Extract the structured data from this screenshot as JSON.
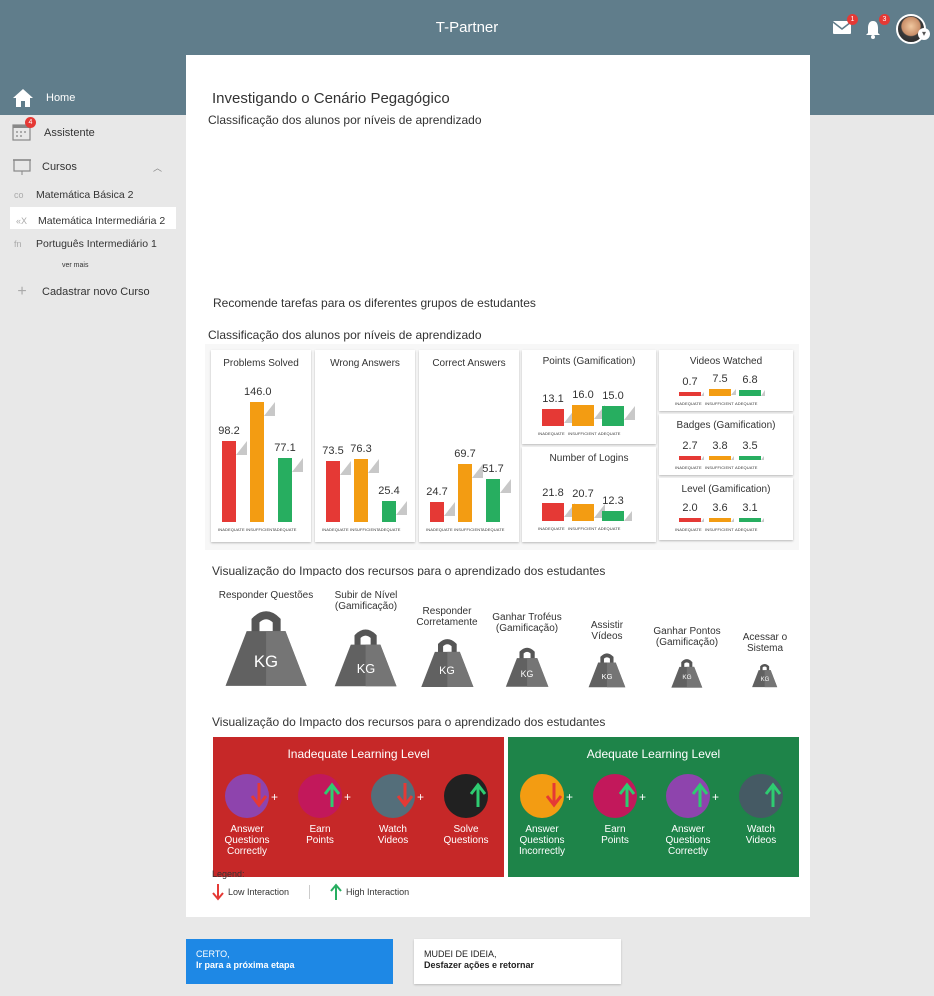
{
  "app": {
    "title": "T-Partner",
    "mail_count": "1",
    "notif_count": "3"
  },
  "sidebar": {
    "home": "Home",
    "assistant": "Assistente",
    "assistant_badge": "4",
    "courses": "Cursos",
    "courses_list": [
      {
        "icon": "co",
        "label": "Matemática Básica 2"
      },
      {
        "icon": "«X",
        "label": "Matemática Intermediária 2"
      },
      {
        "icon": "fn",
        "label": "Português Intermediário 1"
      }
    ],
    "see_more": "ver mais",
    "add_course": "Cadastrar novo Curso"
  },
  "main": {
    "title": "Investigando o Cenário Pegagógico",
    "subtitle1": "Classificação dos alunos por níveis de aprendizado",
    "recommend": "Recomende tarefas para os diferentes grupos de estudantes",
    "subtitle2": "Classificação dos alunos por níveis de aprendizado",
    "viz1": "Visualização do Impacto dos recursos para o aprendizado dos estudantes",
    "viz2": "Visualização do Impacto dos recursos para o aprendizado dos estudantes"
  },
  "chart_data": [
    {
      "type": "bar",
      "title": "Problems Solved",
      "categories": [
        "INADEQUATE",
        "INSUFFICIENT",
        "ADEQUATE"
      ],
      "values": [
        98.2,
        146.0,
        77.1
      ]
    },
    {
      "type": "bar",
      "title": "Wrong Answers",
      "categories": [
        "INADEQUATE",
        "INSUFFICIENT",
        "ADEQUATE"
      ],
      "values": [
        73.5,
        76.3,
        25.4
      ]
    },
    {
      "type": "bar",
      "title": "Correct Answers",
      "categories": [
        "INADEQUATE",
        "INSUFFICIENT",
        "ADEQUATE"
      ],
      "values": [
        24.7,
        69.7,
        51.7
      ]
    },
    {
      "type": "bar",
      "title": "Points (Gamification)",
      "categories": [
        "INADEQUATE",
        "INSUFFICIENT",
        "ADEQUATE"
      ],
      "values": [
        13.1,
        16.0,
        15.0
      ]
    },
    {
      "type": "bar",
      "title": "Number of Logins",
      "categories": [
        "INADEQUATE",
        "INSUFFICIENT",
        "ADEQUATE"
      ],
      "values": [
        21.8,
        20.7,
        12.3
      ]
    },
    {
      "type": "bar",
      "title": "Videos Watched",
      "categories": [
        "INADEQUATE",
        "INSUFFICIENT",
        "ADEQUATE"
      ],
      "values": [
        0.7,
        7.5,
        6.8
      ]
    },
    {
      "type": "bar",
      "title": "Badges (Gamification)",
      "categories": [
        "INADEQUATE",
        "INSUFFICIENT",
        "ADEQUATE"
      ],
      "values": [
        2.7,
        3.8,
        3.5
      ]
    },
    {
      "type": "bar",
      "title": "Level (Gamification)",
      "categories": [
        "INADEQUATE",
        "INSUFFICIENT",
        "ADEQUATE"
      ],
      "values": [
        2.0,
        3.6,
        3.1
      ]
    }
  ],
  "value_labels": {
    "problems": [
      "98.2",
      "146.0",
      "77.1"
    ],
    "wrong": [
      "73.5",
      "76.3",
      "25.4"
    ],
    "correct": [
      "24.7",
      "69.7",
      "51.7"
    ],
    "points": [
      "13.1",
      "16.0",
      "15.0"
    ],
    "logins": [
      "21.8",
      "20.7",
      "12.3"
    ],
    "videos": [
      "0.7",
      "7.5",
      "6.8"
    ],
    "badges": [
      "2.7",
      "3.8",
      "3.5"
    ],
    "level": [
      "2.0",
      "3.6",
      "3.1"
    ],
    "axis": [
      "INADEQUATE",
      "INSUFFICIENT",
      "ADEQUATE"
    ]
  },
  "weights": {
    "unit": "KG",
    "items": [
      "Responder Questões",
      "Subir de Nível\n(Gamificação)",
      "Responder\nCorretamente",
      "Ganhar Troféus\n(Gamificação)",
      "Assistir\nVídeos",
      "Ganhar Pontos\n(Gamificação)",
      "Acessar o\nSistema"
    ]
  },
  "impact": {
    "inadequate_title": "Inadequate Learning Level",
    "adequate_title": "Adequate Learning Level",
    "inadequate": [
      "Answer\nQuestions\nCorrectly",
      "Earn\nPoints",
      "Watch\nVideos",
      "Solve\nQuestions"
    ],
    "adequate": [
      "Answer\nQuestions\nIncorrectly",
      "Earn\nPoints",
      "Answer\nQuestions\nCorrectly",
      "Watch\nVideos"
    ],
    "inadequate_color": "#c62828",
    "adequate_color": "#1e8449"
  },
  "legend": {
    "title": "Legend:",
    "low": "Low Interaction",
    "high": "High Interaction"
  },
  "buttons": {
    "confirm_line1": "CERTO,",
    "confirm_line2": "Ir para a próxima etapa",
    "undo_line1": "MUDEI DE IDEIA,",
    "undo_line2": "Desfazer ações e retornar"
  }
}
